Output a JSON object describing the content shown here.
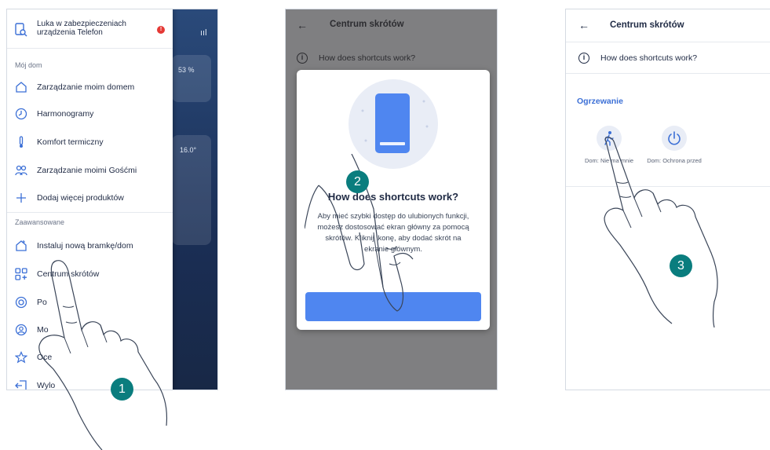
{
  "screen1": {
    "background_values": {
      "percent": "53 %",
      "temperature": "16.0°"
    },
    "alert": {
      "text": "Luka w zabezpieczeniach urządzenia Telefon",
      "badge": "!"
    },
    "section_home": "Mój dom",
    "home_items": [
      {
        "label": "Zarządzanie moim domem",
        "icon": "home-icon"
      },
      {
        "label": "Harmonogramy",
        "icon": "clock-icon"
      },
      {
        "label": "Komfort termiczny",
        "icon": "thermometer-icon"
      },
      {
        "label": "Zarządzanie moimi Gośćmi",
        "icon": "guests-icon"
      },
      {
        "label": "Dodaj więcej produktów",
        "icon": "plus-icon"
      }
    ],
    "section_advanced": "Zaawansowane",
    "advanced_items": [
      {
        "label": "Instaluj nową bramkę/dom",
        "icon": "house-add-icon"
      },
      {
        "label": "Centrum skrótów",
        "icon": "shortcuts-icon"
      },
      {
        "label": "Po",
        "icon": "help-icon"
      },
      {
        "label": "Mo",
        "icon": "profile-icon"
      },
      {
        "label": "Oce",
        "icon": "star-icon"
      },
      {
        "label": "Wylo",
        "icon": "logout-icon"
      }
    ]
  },
  "screen2": {
    "title": "Centrum skrótów",
    "info_text": "How does shortcuts work?",
    "modal": {
      "title": "How does shortcuts work?",
      "body": "Aby mieć szybki dostęp do ulubionych funkcji, możesz dostosować ekran główny za pomocą skrótów. Kliknij ikonę, aby dodać skrót na ekranie głównym.",
      "button": ""
    }
  },
  "screen3": {
    "title": "Centrum skrótów",
    "info_text": "How does shortcuts work?",
    "group_title": "Ogrzewanie",
    "shortcuts": [
      {
        "label": "Dom: Nie ma mnie",
        "icon": "walking-person-icon"
      },
      {
        "label": "Dom: Ochrona przed",
        "icon": "power-icon"
      }
    ]
  },
  "steps": [
    "1",
    "2",
    "3"
  ],
  "colors": {
    "accent": "#4f86f0",
    "step_badge": "#0a7d7e",
    "alert_red": "#e53935",
    "link_blue": "#3b6fd6"
  }
}
